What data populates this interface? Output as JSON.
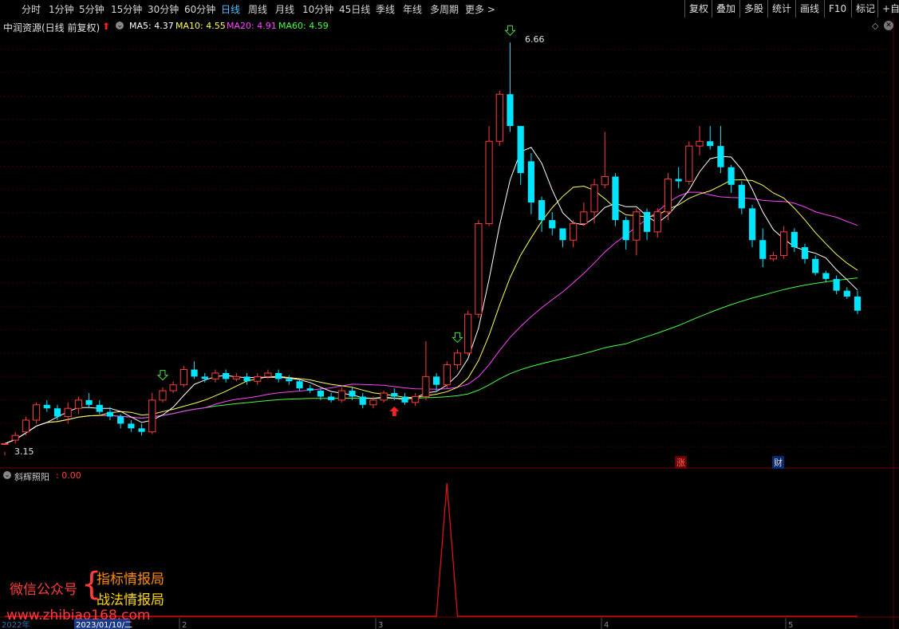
{
  "toolbar": {
    "periods": [
      "分时",
      "1分钟",
      "5分钟",
      "15分钟",
      "30分钟",
      "60分钟",
      "日线",
      "周线",
      "月线",
      "10分钟",
      "45日线",
      "季线",
      "年线",
      "多周期",
      "更多 >"
    ],
    "active_period": "日线",
    "right_buttons": [
      "复权",
      "叠加",
      "多股",
      "统计",
      "画线",
      "F10",
      "标记",
      "+自选"
    ]
  },
  "header": {
    "title": "中润资源(日线 前复权)",
    "ma_labels": [
      {
        "text": "MA5: 4.37",
        "color": "#ffffff"
      },
      {
        "text": "MA10: 4.55",
        "color": "#ffff55"
      },
      {
        "text": "MA20: 4.91",
        "color": "#ff44ff"
      },
      {
        "text": "MA60: 4.59",
        "color": "#44ff44"
      }
    ]
  },
  "chart_data": {
    "type": "candlestick",
    "price_range": [
      3.05,
      6.75
    ],
    "high_label": "6.66",
    "low_label": "3.15",
    "colors": {
      "up": "#ff3d3d",
      "down": "#00e5ff",
      "ma5": "#ffffff",
      "ma10": "#ffff55",
      "ma20": "#ff44ff",
      "ma60": "#44ff44",
      "signal": "#dd1111",
      "grid": "#3a0000"
    },
    "candles": [
      [
        3.25,
        3.25,
        3.18,
        3.15
      ],
      [
        3.28,
        3.32,
        3.35,
        3.25
      ],
      [
        3.35,
        3.45,
        3.48,
        3.32
      ],
      [
        3.45,
        3.58,
        3.6,
        3.42
      ],
      [
        3.58,
        3.55,
        3.62,
        3.52
      ],
      [
        3.55,
        3.48,
        3.58,
        3.45
      ],
      [
        3.48,
        3.55,
        3.6,
        3.42
      ],
      [
        3.55,
        3.62,
        3.65,
        3.5
      ],
      [
        3.62,
        3.58,
        3.68,
        3.55
      ],
      [
        3.58,
        3.52,
        3.62,
        3.5
      ],
      [
        3.52,
        3.48,
        3.56,
        3.45
      ],
      [
        3.48,
        3.42,
        3.5,
        3.38
      ],
      [
        3.42,
        3.38,
        3.45,
        3.35
      ],
      [
        3.38,
        3.35,
        3.42,
        3.32
      ],
      [
        3.35,
        3.62,
        3.68,
        3.33
      ],
      [
        3.62,
        3.7,
        3.73,
        3.6
      ],
      [
        3.7,
        3.75,
        3.78,
        3.68
      ],
      [
        3.75,
        3.88,
        3.91,
        3.73
      ],
      [
        3.88,
        3.82,
        3.95,
        3.8
      ],
      [
        3.82,
        3.8,
        3.85,
        3.77
      ],
      [
        3.8,
        3.85,
        3.88,
        3.77
      ],
      [
        3.85,
        3.8,
        3.88,
        3.77
      ],
      [
        3.8,
        3.82,
        3.85,
        3.78
      ],
      [
        3.82,
        3.78,
        3.85,
        3.75
      ],
      [
        3.78,
        3.82,
        3.85,
        3.75
      ],
      [
        3.82,
        3.85,
        3.88,
        3.8
      ],
      [
        3.85,
        3.8,
        3.88,
        3.77
      ],
      [
        3.8,
        3.78,
        3.83,
        3.75
      ],
      [
        3.78,
        3.72,
        3.8,
        3.7
      ],
      [
        3.72,
        3.7,
        3.75,
        3.68
      ],
      [
        3.7,
        3.65,
        3.72,
        3.62
      ],
      [
        3.65,
        3.62,
        3.68,
        3.6
      ],
      [
        3.62,
        3.7,
        3.73,
        3.6
      ],
      [
        3.7,
        3.65,
        3.73,
        3.62
      ],
      [
        3.65,
        3.58,
        3.68,
        3.55
      ],
      [
        3.58,
        3.62,
        3.65,
        3.55
      ],
      [
        3.62,
        3.68,
        3.7,
        3.6
      ],
      [
        3.68,
        3.65,
        3.72,
        3.62
      ],
      [
        3.65,
        3.6,
        3.68,
        3.58
      ],
      [
        3.6,
        3.65,
        3.68,
        3.57
      ],
      [
        3.65,
        3.82,
        4.12,
        3.62
      ],
      [
        3.82,
        3.75,
        3.85,
        3.7
      ],
      [
        3.75,
        3.92,
        3.95,
        3.72
      ],
      [
        3.92,
        4.02,
        4.05,
        3.88
      ],
      [
        4.02,
        4.35,
        4.38,
        4.0
      ],
      [
        4.35,
        5.12,
        5.15,
        4.32
      ],
      [
        5.12,
        5.82,
        5.95,
        5.1
      ],
      [
        5.82,
        6.22,
        6.25,
        5.78
      ],
      [
        6.22,
        5.95,
        6.66,
        5.9
      ],
      [
        5.95,
        5.55,
        5.72,
        5.45
      ],
      [
        5.65,
        5.3,
        5.72,
        5.2
      ],
      [
        5.32,
        5.15,
        5.35,
        5.05
      ],
      [
        5.15,
        5.08,
        5.22,
        5.02
      ],
      [
        5.08,
        4.98,
        5.08,
        4.92
      ],
      [
        4.98,
        5.12,
        5.15,
        4.92
      ],
      [
        5.12,
        5.22,
        5.3,
        5.1
      ],
      [
        5.22,
        5.45,
        5.5,
        5.12
      ],
      [
        5.45,
        5.52,
        5.9,
        5.42
      ],
      [
        5.52,
        5.15,
        5.55,
        5.1
      ],
      [
        5.15,
        4.98,
        5.18,
        4.9
      ],
      [
        4.98,
        5.22,
        5.25,
        4.85
      ],
      [
        5.22,
        5.05,
        5.25,
        4.98
      ],
      [
        5.05,
        5.22,
        5.25,
        5.0
      ],
      [
        5.22,
        5.5,
        5.55,
        5.15
      ],
      [
        5.5,
        5.48,
        5.6,
        5.42
      ],
      [
        5.48,
        5.78,
        5.82,
        5.45
      ],
      [
        5.78,
        5.82,
        5.95,
        5.7
      ],
      [
        5.82,
        5.78,
        5.95,
        5.75
      ],
      [
        5.78,
        5.6,
        5.95,
        5.55
      ],
      [
        5.6,
        5.45,
        5.62,
        5.38
      ],
      [
        5.45,
        5.25,
        5.48,
        5.2
      ],
      [
        5.25,
        4.98,
        5.28,
        4.92
      ],
      [
        4.98,
        4.82,
        5.08,
        4.75
      ],
      [
        4.82,
        4.85,
        4.88,
        4.8
      ],
      [
        4.85,
        5.05,
        5.1,
        4.82
      ],
      [
        5.05,
        4.92,
        5.08,
        4.88
      ],
      [
        4.92,
        4.82,
        4.95,
        4.78
      ],
      [
        4.82,
        4.7,
        4.85,
        4.68
      ],
      [
        4.7,
        4.65,
        4.72,
        4.62
      ],
      [
        4.65,
        4.55,
        4.68,
        4.52
      ],
      [
        4.55,
        4.5,
        4.58,
        4.48
      ],
      [
        4.5,
        4.38,
        4.55,
        4.35
      ]
    ],
    "signals": {
      "down_arrows": [
        15,
        43,
        48
      ],
      "up_arrows": [
        37
      ]
    },
    "badges": [
      "涨",
      "财"
    ],
    "indicator": {
      "name": "斜辉照阳",
      "value": ": 0.00",
      "spike_at": 42,
      "spike_value": 1.0
    },
    "x_labels": [
      "2022年",
      "2023/01/10/二",
      "2",
      "3",
      "4",
      "5"
    ]
  },
  "watermark": {
    "left": "微信公众号",
    "brace": "{",
    "line1": "指标情报局",
    "line2": "战法情报局",
    "url": "www.zhibiao168.com"
  }
}
